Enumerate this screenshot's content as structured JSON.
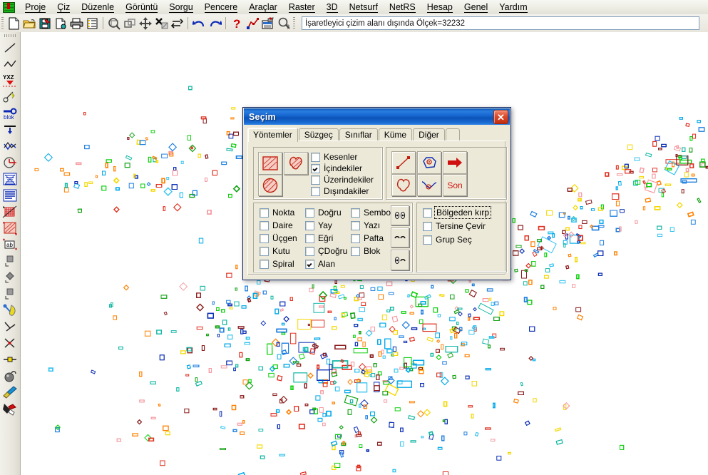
{
  "app": {
    "logo_icon": "netcad-app-icon"
  },
  "menubar": {
    "items": [
      {
        "label": "Proje"
      },
      {
        "label": "Çiz"
      },
      {
        "label": "Düzenle"
      },
      {
        "label": "Görüntü"
      },
      {
        "label": "Sorgu"
      },
      {
        "label": "Pencere"
      },
      {
        "label": "Araçlar"
      },
      {
        "label": "Raster"
      },
      {
        "label": "3D"
      },
      {
        "label": "Netsurf"
      },
      {
        "label": "NetRS"
      },
      {
        "label": "Hesap"
      },
      {
        "label": "Genel"
      },
      {
        "label": "Yardım"
      }
    ]
  },
  "toolbar": {
    "buttons": [
      {
        "name": "new-document-icon",
        "title": "Yeni"
      },
      {
        "name": "open-folder-icon",
        "title": "Aç"
      },
      {
        "name": "save-project-icon",
        "title": "Kaydet"
      },
      {
        "name": "save-as-icon",
        "title": "Farklı Kaydet"
      },
      {
        "name": "print-icon",
        "title": "Yazdır"
      },
      {
        "name": "list-icon",
        "title": "Liste"
      },
      {
        "name": "zoom-window-icon",
        "title": "Pencere Zoom"
      },
      {
        "name": "zoom-previous-icon",
        "title": "Önceki Görüntü"
      },
      {
        "name": "pan-move-icon",
        "title": "Kaydır"
      },
      {
        "name": "zoom-all-icon",
        "title": "Tümünü Göster"
      },
      {
        "name": "zoom-dynamic-icon",
        "title": "Dinamik Zoom"
      },
      {
        "name": "undo-icon",
        "title": "Geri Al"
      },
      {
        "name": "redo-icon",
        "title": "İleri Al"
      },
      {
        "name": "help-question-icon",
        "title": "Yardım"
      },
      {
        "name": "measure-polyline-icon",
        "title": "Ölçüm"
      },
      {
        "name": "table-edit-icon",
        "title": "Tablo"
      },
      {
        "name": "query-magnifier-icon",
        "title": "Sorgula"
      }
    ],
    "status": {
      "value": "İşaretleyici çizim alanı dışında Ölçek=32232",
      "placeholder": ""
    }
  },
  "left_toolbar": {
    "buttons": [
      {
        "name": "line-icon",
        "title": "Doğru"
      },
      {
        "name": "polyline-icon",
        "title": "Çoklu Doğru"
      },
      {
        "name": "yxz-point-icon",
        "title": "YXZ Nokta"
      },
      {
        "name": "scissors-node-icon",
        "title": "Kes"
      },
      {
        "name": "block-icon",
        "title": "blok"
      },
      {
        "name": "offset-down-icon",
        "title": "Offset"
      },
      {
        "name": "polyline-vertex-icon",
        "title": "Köşe"
      },
      {
        "name": "clock-arc-icon",
        "title": "Yay"
      },
      {
        "name": "hatch-text-icon",
        "title": "Tarama Yazı"
      },
      {
        "name": "text-lines-icon",
        "title": "Yazı"
      },
      {
        "name": "grid-hatch-icon",
        "title": "Grid Tarama"
      },
      {
        "name": "area-fill-icon",
        "title": "Alan Tarama"
      },
      {
        "name": "label-ab-icon",
        "title": "Etiket"
      },
      {
        "name": "square-corner-icon",
        "title": "Kutu"
      },
      {
        "name": "triangle-icon",
        "title": "Üçgen"
      },
      {
        "name": "square-filled-icon",
        "title": "Dolu Kutu"
      },
      {
        "name": "diamond-corner-icon",
        "title": "Elmas"
      },
      {
        "name": "box-corner-icon",
        "title": "Kutu Köşe"
      },
      {
        "name": "scissors-cut-icon",
        "title": "Makas"
      },
      {
        "name": "angle-icon",
        "title": "Açı"
      },
      {
        "name": "intersection-icon",
        "title": "Kesişim"
      },
      {
        "name": "node-edit-icon",
        "title": "Nokta Düzenle"
      },
      {
        "name": "bomb-icon",
        "title": "Patlat"
      },
      {
        "name": "brush-icon",
        "title": "Fırça"
      },
      {
        "name": "eraser-icon",
        "title": "Silgi"
      }
    ]
  },
  "dialog": {
    "title": "Seçim",
    "close_label": "✕",
    "close_icon": "close-icon",
    "tabs": [
      {
        "label": "Yöntemler",
        "selected": true
      },
      {
        "label": "Süzgeç",
        "selected": false
      },
      {
        "label": "Sınıflar",
        "selected": false
      },
      {
        "label": "Küme",
        "selected": false
      },
      {
        "label": "Diğer",
        "selected": false
      }
    ],
    "shape_group": {
      "buttons": [
        {
          "name": "select-rectangle-icon",
          "title": "Dikdörtgen ile Seç"
        },
        {
          "name": "select-freehand-polygon-icon",
          "title": "Serbest Alan ile Seç"
        },
        {
          "name": "select-circle-icon",
          "title": "Daire ile Seç"
        }
      ],
      "checkboxes": [
        {
          "label": "Kesenler",
          "checked": false
        },
        {
          "label": "İçindekiler",
          "checked": true
        },
        {
          "label": "Üzerindekiler",
          "checked": false
        },
        {
          "label": "Dışındakiler",
          "checked": false
        }
      ]
    },
    "tools_group": {
      "buttons": [
        {
          "name": "select-line-icon",
          "title": "Doğru ile Seç"
        },
        {
          "name": "select-object-node-icon",
          "title": "Obje Seç"
        },
        {
          "name": "select-all-arrow-icon",
          "title": "Tümünü Seç"
        },
        {
          "name": "select-polygon-icon",
          "title": "Poligon ile Seç"
        },
        {
          "name": "select-curve-icon",
          "title": "Eğri ile Seç"
        },
        {
          "name": "select-last-button",
          "label": "Son",
          "title": "Son Seçim"
        }
      ]
    },
    "types_group": {
      "columns": [
        [
          {
            "label": "Nokta",
            "checked": false
          },
          {
            "label": "Daire",
            "checked": false
          },
          {
            "label": "Üçgen",
            "checked": false
          },
          {
            "label": "Kutu",
            "checked": false
          },
          {
            "label": "Spiral",
            "checked": false
          }
        ],
        [
          {
            "label": "Doğru",
            "checked": false
          },
          {
            "label": "Yay",
            "checked": false
          },
          {
            "label": "Eğri",
            "checked": false
          },
          {
            "label": "ÇDoğru",
            "checked": false
          },
          {
            "label": "Alan",
            "checked": true
          }
        ],
        [
          {
            "label": "Sembol",
            "checked": false
          },
          {
            "label": "Yazı",
            "checked": false
          },
          {
            "label": "Pafta",
            "checked": false
          },
          {
            "label": "Blok",
            "checked": false
          }
        ]
      ],
      "side_buttons": [
        {
          "name": "select-all-types-icon",
          "title": "Tümünü İşaretle"
        },
        {
          "name": "clear-all-types-icon",
          "title": "Tümünü Temizle"
        },
        {
          "name": "invert-types-icon",
          "title": "Ters Çevir"
        }
      ]
    },
    "extra_group": {
      "checkboxes": [
        {
          "label": "Bölgeden kırp",
          "checked": false,
          "focused": true
        },
        {
          "label": "Tersine Çevir",
          "checked": false,
          "focused": false
        },
        {
          "label": "Grup Seç",
          "checked": false,
          "focused": false
        }
      ]
    }
  },
  "canvas": {
    "name": "cad-drawing-area",
    "background": "#ffffff",
    "description": "Kadastral harita - renkli parsel ve bina poligonları",
    "palette": [
      "#1e7fe0",
      "#00a8e8",
      "#0b2fb4",
      "#35c3f0",
      "#e03020",
      "#ff8000",
      "#f5d800",
      "#17a317",
      "#0fd00f",
      "#f59aa0",
      "#8b1a1a",
      "#14b8a6"
    ]
  },
  "colors": {
    "accent": "#0a246a",
    "titlebar_start": "#0b55b5",
    "titlebar_end": "#3a8ae6",
    "dialog_face": "#ece9d8",
    "toolbar_face": "#e8e6dc",
    "close_button": "#dc4a2a",
    "red_text": "#d01010"
  }
}
